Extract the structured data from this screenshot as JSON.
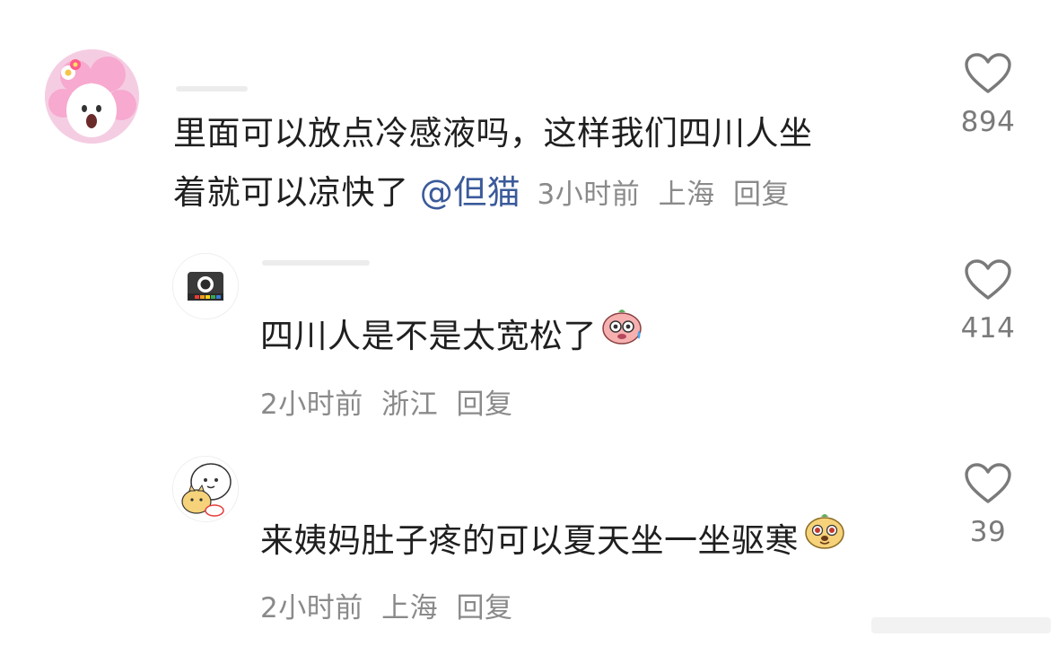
{
  "comments": [
    {
      "text_line1": "里面可以放点冷感液吗，这样我们四川人坐",
      "text_line2": "着就可以凉快了",
      "mention": "@但猫",
      "time": "3小时前",
      "location": "上海",
      "reply_label": "回复",
      "likes": "894"
    },
    {
      "text": "四川人是不是太宽松了",
      "time": "2小时前",
      "location": "浙江",
      "reply_label": "回复",
      "likes": "414"
    },
    {
      "text": "来姨妈肚子疼的可以夏天坐一坐驱寒",
      "time": "2小时前",
      "location": "上海",
      "reply_label": "回复",
      "likes": "39"
    }
  ],
  "colors": {
    "text": "#1f1f1f",
    "meta": "#8a8a8a",
    "mention": "#3a5a9a",
    "icon": "#7a7a7a"
  }
}
